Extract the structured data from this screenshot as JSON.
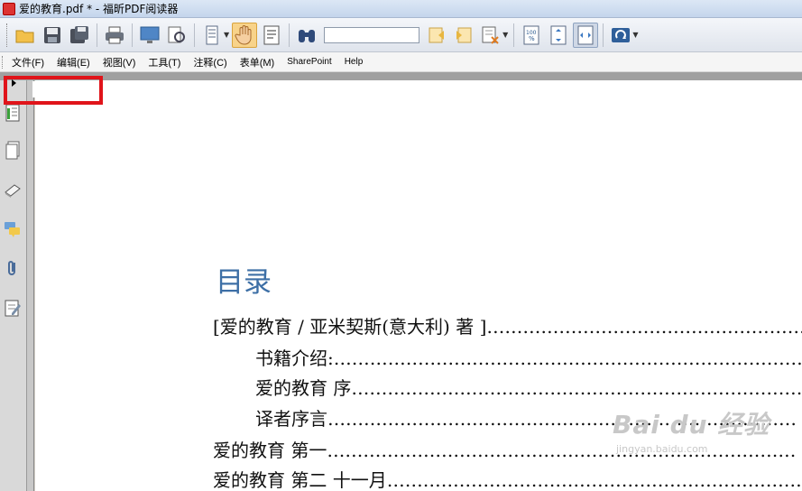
{
  "window": {
    "title": "爱的教育.pdf * - 福昕PDF阅读器"
  },
  "toolbar": {
    "search_value": "",
    "buttons": [
      {
        "name": "open-icon"
      },
      {
        "name": "save-icon"
      },
      {
        "name": "save-as-icon"
      },
      {
        "name": "print-icon"
      },
      {
        "name": "fullscreen-icon"
      },
      {
        "name": "find-document-icon"
      },
      {
        "name": "page-layout-icon"
      },
      {
        "name": "hand-tool-icon"
      },
      {
        "name": "select-text-icon"
      },
      {
        "name": "binoculars-icon"
      },
      {
        "name": "find-previous-icon"
      },
      {
        "name": "find-next-icon"
      },
      {
        "name": "highlight-search-icon"
      },
      {
        "name": "actual-size-icon"
      },
      {
        "name": "fit-page-icon"
      },
      {
        "name": "fit-width-icon"
      },
      {
        "name": "rotate-icon"
      }
    ]
  },
  "menu": {
    "items": [
      "文件(F)",
      "编辑(E)",
      "视图(V)",
      "工具(T)",
      "注释(C)",
      "表单(M)",
      "SharePoint",
      "Help"
    ]
  },
  "sidebar": {
    "icons": [
      "bookmarks-icon",
      "pages-icon",
      "layers-icon",
      "comments-icon",
      "attachments-icon",
      "signature-icon"
    ]
  },
  "document": {
    "toc_title": "目录",
    "entries": [
      {
        "text": "[爱的教育  /  亚米契斯(意大利)  著  ]",
        "indent": 0
      },
      {
        "text": "书籍介绍:",
        "indent": 1
      },
      {
        "text": "爱的教育  序",
        "indent": 1
      },
      {
        "text": "译者序言",
        "indent": 1
      },
      {
        "text": "爱的教育  第一",
        "indent": 0
      },
      {
        "text": "爱的教育  第二  十一月",
        "indent": 0
      }
    ]
  },
  "watermark": {
    "main": "Bai du 经验",
    "sub": "jingyan.baidu.com"
  },
  "colors": {
    "toc_title": "#3d6fa6",
    "highlight": "#e0141a"
  }
}
